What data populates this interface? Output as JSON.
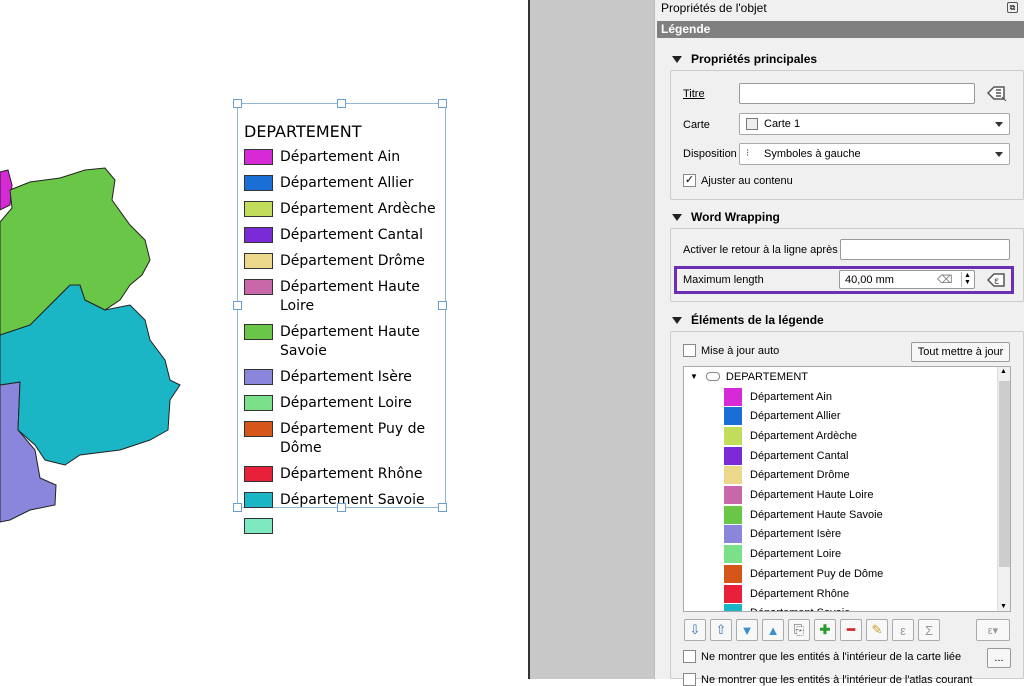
{
  "panel": {
    "title": "Propriétés de l'objet",
    "section": "Légende",
    "main_props": {
      "title": "Propriétés principales",
      "titre_label": "Titre",
      "titre_value": "",
      "carte_label": "Carte",
      "carte_value": "Carte 1",
      "disposition_label": "Disposition",
      "disposition_value": "Symboles à gauche",
      "ajuster_label": "Ajuster au contenu",
      "ajuster_checked": "✓"
    },
    "wrapping": {
      "title": "Word Wrapping",
      "retour_label": "Activer le retour à la ligne après",
      "retour_value": "",
      "maxlen_label": "Maximum length",
      "maxlen_value": "40,00 mm"
    },
    "elements": {
      "title": "Éléments de la légende",
      "auto_label": "Mise à jour auto",
      "update_all_label": "Tout mettre à jour",
      "root_label": "DEPARTEMENT",
      "items": [
        {
          "label": "Département Ain",
          "color": "#d62ad6"
        },
        {
          "label": "Département Allier",
          "color": "#1a6fd6"
        },
        {
          "label": "Département Ardèche",
          "color": "#c2dc5c"
        },
        {
          "label": "Département Cantal",
          "color": "#7a2ad6"
        },
        {
          "label": "Département Drôme",
          "color": "#ecd88a"
        },
        {
          "label": "Département Haute Loire",
          "color": "#c868a8"
        },
        {
          "label": "Département Haute Savoie",
          "color": "#6ac646"
        },
        {
          "label": "Département Isère",
          "color": "#8a86dc"
        },
        {
          "label": "Département Loire",
          "color": "#7ae08a"
        },
        {
          "label": "Département Puy de Dôme",
          "color": "#d6561a"
        },
        {
          "label": "Département Rhône",
          "color": "#e8203a"
        },
        {
          "label": "Département Savoie",
          "color": "#1ab6c6"
        }
      ],
      "only_inside_label": "Ne montrer que les entités à l'intérieur de la carte liée",
      "more_button": "...",
      "cut_label": "Ne montrer que les entités à l'intérieur de l'atlas courant"
    }
  },
  "legend": {
    "title": "DEPARTEMENT",
    "items": [
      {
        "label": "Département Ain",
        "color": "#d62ad6"
      },
      {
        "label": "Département Allier",
        "color": "#1a6fd6"
      },
      {
        "label": "Département Ardèche",
        "color": "#c2dc5c"
      },
      {
        "label": "Département Cantal",
        "color": "#7a2ad6"
      },
      {
        "label": "Département Drôme",
        "color": "#ecd88a"
      },
      {
        "label": "Département Haute Loire",
        "color": "#c868a8"
      },
      {
        "label": "Département Haute Savoie",
        "color": "#6ac646"
      },
      {
        "label": "Département Isère",
        "color": "#8a86dc"
      },
      {
        "label": "Département Loire",
        "color": "#7ae08a"
      },
      {
        "label": "Département Puy de Dôme",
        "color": "#d6561a"
      },
      {
        "label": "Département Rhône",
        "color": "#e8203a"
      },
      {
        "label": "Département Savoie",
        "color": "#1ab6c6"
      },
      {
        "label": "",
        "color": "#7ee8c0"
      }
    ]
  },
  "toolbar_icons": [
    "move-down-icon",
    "move-up-icon",
    "arrow-down-icon",
    "arrow-up-icon",
    "group-icon",
    "add-icon",
    "remove-icon",
    "edit-icon",
    "expression-icon",
    "sum-icon",
    "filter-expression-icon"
  ]
}
